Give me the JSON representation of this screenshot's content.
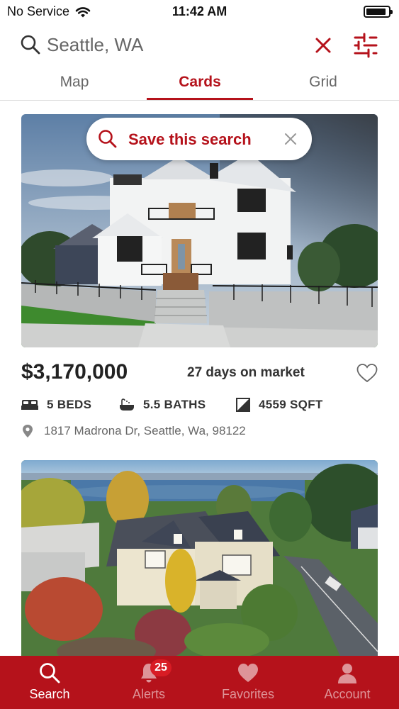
{
  "status_bar": {
    "carrier": "No Service",
    "time": "11:42 AM"
  },
  "search": {
    "query": "Seattle, WA"
  },
  "tabs": [
    {
      "label": "Map",
      "active": false
    },
    {
      "label": "Cards",
      "active": true
    },
    {
      "label": "Grid",
      "active": false
    }
  ],
  "save_search": {
    "label": "Save this search"
  },
  "listings": [
    {
      "price": "$3,170,000",
      "days_on_market": "27 days on market",
      "beds": "5 BEDS",
      "baths": "5.5 BATHS",
      "sqft": "4559 SQFT",
      "address": "1817 Madrona Dr, Seattle, Wa, 98122",
      "favorited": false
    },
    {
      "photo": "aerial-house-photo"
    }
  ],
  "tabbar": [
    {
      "label": "Search",
      "icon": "search-icon",
      "active": true
    },
    {
      "label": "Alerts",
      "icon": "bell-icon",
      "active": false,
      "badge": "25"
    },
    {
      "label": "Favorites",
      "icon": "heart-icon",
      "active": false
    },
    {
      "label": "Account",
      "icon": "person-icon",
      "active": false
    }
  ],
  "colors": {
    "accent": "#b5121b",
    "tabbar_bg": "#b5121b",
    "badge": "#d81c24"
  }
}
